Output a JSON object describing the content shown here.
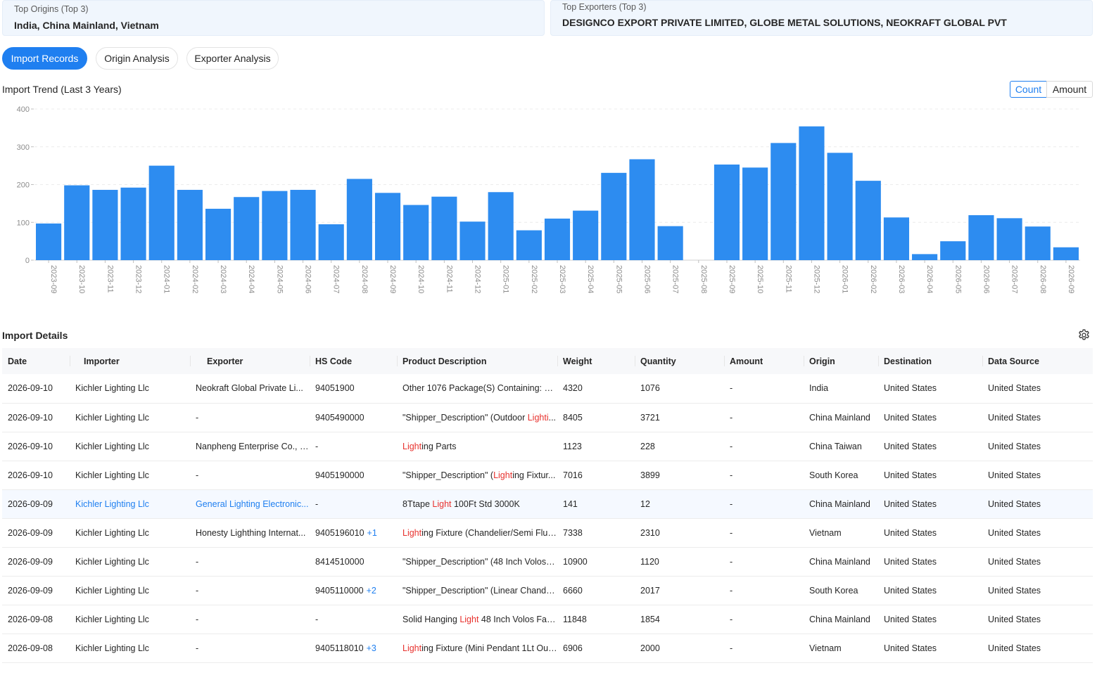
{
  "summary": {
    "origins_label": "Top Origins (Top 3)",
    "origins_value": "India, China Mainland, Vietnam",
    "exporters_label": "Top Exporters (Top 3)",
    "exporters_value": "DESIGNCO EXPORT PRIVATE LIMITED, GLOBE METAL SOLUTIONS, NEOKRAFT GLOBAL PVT"
  },
  "tabs": [
    {
      "label": "Import Records",
      "active": true
    },
    {
      "label": "Origin Analysis",
      "active": false
    },
    {
      "label": "Exporter Analysis",
      "active": false
    }
  ],
  "chart": {
    "title": "Import Trend (Last 3 Years)",
    "toggle_count": "Count",
    "toggle_amount": "Amount",
    "active_toggle": "Count"
  },
  "colors": {
    "accent": "#1f7ff0",
    "bar": "#2d8cf0",
    "highlight": "#e8312d"
  },
  "chart_data": {
    "type": "bar",
    "title": "Import Trend (Last 3 Years)",
    "ylim": [
      0,
      400
    ],
    "yticks": [
      0,
      100,
      200,
      300,
      400
    ],
    "grid": true,
    "categories": [
      "2023-09",
      "2023-10",
      "2023-11",
      "2023-12",
      "2024-01",
      "2024-02",
      "2024-03",
      "2024-04",
      "2024-05",
      "2024-06",
      "2024-07",
      "2024-08",
      "2024-09",
      "2024-10",
      "2024-11",
      "2024-12",
      "2025-01",
      "2025-02",
      "2025-03",
      "2025-04",
      "2025-05",
      "2025-06",
      "2025-07",
      "2025-08",
      "2025-09",
      "2025-10",
      "2025-11",
      "2025-12",
      "2026-01",
      "2026-02",
      "2026-03",
      "2026-04",
      "2026-05",
      "2026-06",
      "2026-07",
      "2026-08",
      "2026-09"
    ],
    "values": [
      97,
      198,
      186,
      192,
      250,
      186,
      136,
      167,
      183,
      186,
      95,
      215,
      178,
      146,
      168,
      102,
      180,
      79,
      110,
      131,
      231,
      267,
      90,
      0,
      253,
      245,
      310,
      354,
      284,
      210,
      113,
      16,
      50,
      119,
      111,
      89,
      34
    ]
  },
  "details": {
    "title": "Import Details",
    "settings_icon": "gear-icon",
    "columns": [
      "Date",
      "Importer",
      "Exporter",
      "HS Code",
      "Product Description",
      "Weight",
      "Quantity",
      "Amount",
      "Origin",
      "Destination",
      "Data Source"
    ],
    "rows": [
      {
        "date": "2026-09-10",
        "importer": "Kichler Lighting Llc",
        "exporter": "Neokraft Global Private Li...",
        "hs": "94051900",
        "hs_extra": "",
        "desc_pre": "Other 1076 Package(S) Containing: Ho...",
        "desc_hl": "",
        "desc_post": "",
        "weight": "4320",
        "quantity": "1076",
        "amount": "-",
        "origin": "India",
        "destination": "United States",
        "source": "United States"
      },
      {
        "date": "2026-09-10",
        "importer": "Kichler Lighting Llc",
        "exporter": "-",
        "hs": "9405490000",
        "hs_extra": "",
        "desc_pre": "\"Shipper_Description\" (Outdoor ",
        "desc_hl": "Lighti",
        "desc_post": "...",
        "weight": "8405",
        "quantity": "3721",
        "amount": "-",
        "origin": "China Mainland",
        "destination": "United States",
        "source": "United States"
      },
      {
        "date": "2026-09-10",
        "importer": "Kichler Lighting Llc",
        "exporter": "Nanpheng Enterprise Co., L...",
        "hs": "-",
        "hs_extra": "",
        "desc_pre": "",
        "desc_hl": "Light",
        "desc_post": "ing Parts",
        "weight": "1123",
        "quantity": "228",
        "amount": "-",
        "origin": "China Taiwan",
        "destination": "United States",
        "source": "United States"
      },
      {
        "date": "2026-09-10",
        "importer": "Kichler Lighting Llc",
        "exporter": "-",
        "hs": "9405190000",
        "hs_extra": "",
        "desc_pre": "\"Shipper_Description\" (",
        "desc_hl": "Light",
        "desc_post": "ing Fixtur...",
        "weight": "7016",
        "quantity": "3899",
        "amount": "-",
        "origin": "South Korea",
        "destination": "United States",
        "source": "United States"
      },
      {
        "date": "2026-09-09",
        "importer": "Kichler Lighting Llc",
        "exporter": "General Lighting Electronic...",
        "hs": "-",
        "hs_extra": "",
        "desc_pre": "8Ttape ",
        "desc_hl": "Light",
        "desc_post": " 100Ft Std 3000K",
        "weight": "141",
        "quantity": "12",
        "amount": "-",
        "origin": "China Mainland",
        "destination": "United States",
        "source": "United States"
      },
      {
        "date": "2026-09-09",
        "importer": "Kichler Lighting Llc",
        "exporter": "Honesty Lighthing Internat...",
        "hs": "9405196010",
        "hs_extra": "+1",
        "desc_pre": "",
        "desc_hl": "Light",
        "desc_post": "ing Fixture (Chandelier/Semi Flus...",
        "weight": "7338",
        "quantity": "2310",
        "amount": "-",
        "origin": "Vietnam",
        "destination": "United States",
        "source": "United States"
      },
      {
        "date": "2026-09-09",
        "importer": "Kichler Lighting Llc",
        "exporter": "-",
        "hs": "8414510000",
        "hs_extra": "",
        "desc_pre": "\"Shipper_Description\" (48 Inch Volos F...",
        "desc_hl": "",
        "desc_post": "",
        "weight": "10900",
        "quantity": "1120",
        "amount": "-",
        "origin": "China Mainland",
        "destination": "United States",
        "source": "United States"
      },
      {
        "date": "2026-09-09",
        "importer": "Kichler Lighting Llc",
        "exporter": "-",
        "hs": "9405110000",
        "hs_extra": "+2",
        "desc_pre": "\"Shipper_Description\" (Linear Chandel...",
        "desc_hl": "",
        "desc_post": "",
        "weight": "6660",
        "quantity": "2017",
        "amount": "-",
        "origin": "South Korea",
        "destination": "United States",
        "source": "United States"
      },
      {
        "date": "2026-09-08",
        "importer": "Kichler Lighting Llc",
        "exporter": "-",
        "hs": "-",
        "hs_extra": "",
        "desc_pre": "Solid Hanging ",
        "desc_hl": "Light",
        "desc_post": " 48 Inch Volos Fan...",
        "weight": "11848",
        "quantity": "1854",
        "amount": "-",
        "origin": "China Mainland",
        "destination": "United States",
        "source": "United States"
      },
      {
        "date": "2026-09-08",
        "importer": "Kichler Lighting Llc",
        "exporter": "-",
        "hs": "9405118010",
        "hs_extra": "+3",
        "desc_pre": "",
        "desc_hl": "Light",
        "desc_post": "ing Fixture (Mini Pendant 1Lt Out...",
        "weight": "6906",
        "quantity": "2000",
        "amount": "-",
        "origin": "Vietnam",
        "destination": "United States",
        "source": "United States"
      }
    ]
  }
}
